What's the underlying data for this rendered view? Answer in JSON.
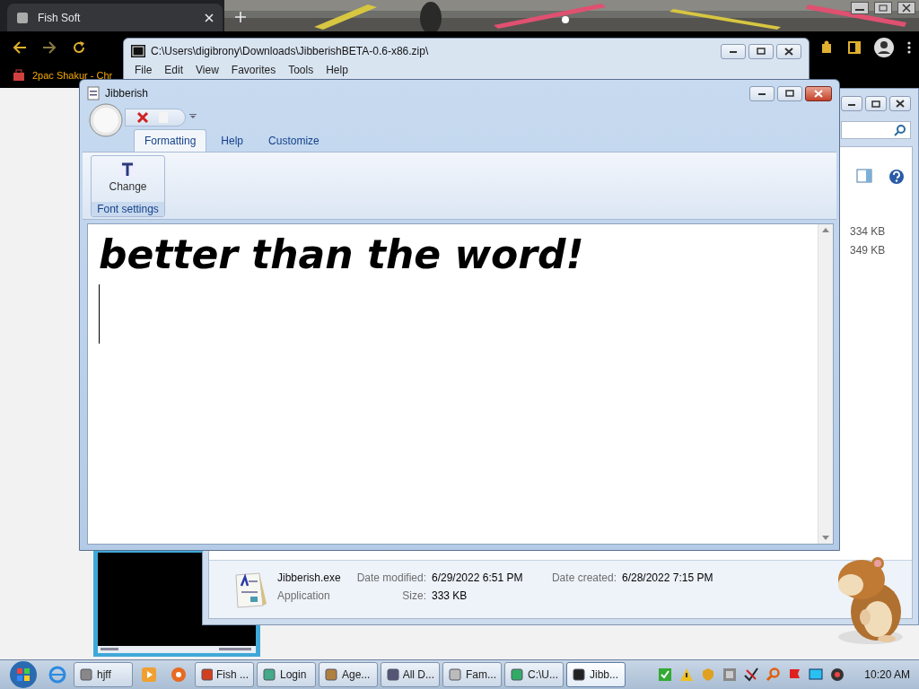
{
  "browser": {
    "tab": {
      "title": "Fish Soft"
    },
    "bookmarks": [
      {
        "label": "2pac Shakur - Chr"
      }
    ]
  },
  "explorer": {
    "sizes": [
      "334 KB",
      "349 KB"
    ],
    "details": {
      "name": "Jibberish.exe",
      "type": "Application",
      "fields": [
        {
          "label": "Date modified:",
          "value": "6/29/2022 6:51 PM"
        },
        {
          "label": "Size:",
          "value": "333 KB"
        },
        {
          "label": "Date created:",
          "value": "6/28/2022 7:15 PM"
        }
      ]
    }
  },
  "archive_window": {
    "title": "C:\\Users\\digibrony\\Downloads\\JibberishBETA-0.6-x86.zip\\",
    "menu": [
      "File",
      "Edit",
      "View",
      "Favorites",
      "Tools",
      "Help"
    ]
  },
  "editor_window": {
    "title": "Jibberish",
    "tabs": [
      {
        "label": "Formatting",
        "selected": true
      },
      {
        "label": "Help",
        "selected": false
      },
      {
        "label": "Customize",
        "selected": false
      }
    ],
    "ribbon_group": {
      "label": "Font settings",
      "button": "Change"
    },
    "document": {
      "text": "better than the word!"
    }
  },
  "taskbar": {
    "items": [
      {
        "label": "hjff",
        "selected": false
      },
      {
        "label": "Fish ...",
        "selected": false
      },
      {
        "label": "Login",
        "selected": false
      },
      {
        "label": "Age...",
        "selected": false
      },
      {
        "label": "All D...",
        "selected": false
      },
      {
        "label": "Fam...",
        "selected": false
      },
      {
        "label": "C:\\U...",
        "selected": false
      },
      {
        "label": "Jibb...",
        "selected": true
      }
    ],
    "clock": "10:20 AM"
  }
}
